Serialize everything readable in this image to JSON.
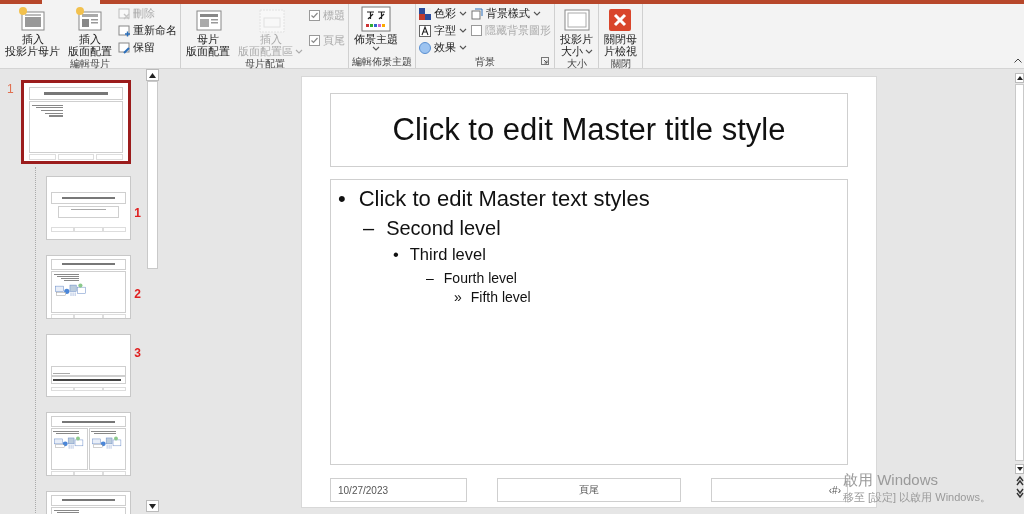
{
  "ribbon": {
    "groups": [
      {
        "label": "編輯母片",
        "items": [
          {
            "kind": "large",
            "lines": [
              "插入",
              "投影片母片"
            ],
            "disabled": false,
            "dropdown": false
          },
          {
            "kind": "large",
            "lines": [
              "插入",
              "版面配置"
            ],
            "disabled": false,
            "dropdown": false
          },
          {
            "kind": "stack",
            "entries": [
              {
                "label": "刪除",
                "disabled": true
              },
              {
                "label": "重新命名",
                "disabled": false
              },
              {
                "label": "保留",
                "disabled": false
              }
            ]
          }
        ]
      },
      {
        "label": "母片配置",
        "items": [
          {
            "kind": "large",
            "lines": [
              "母片",
              "版面配置"
            ],
            "disabled": false,
            "dropdown": false
          },
          {
            "kind": "large",
            "lines": [
              "插入",
              "版面配置區"
            ],
            "disabled": true,
            "dropdown": true
          },
          {
            "kind": "checks",
            "entries": [
              {
                "label": "標題",
                "checked": true,
                "disabled": true
              },
              {
                "label": "頁尾",
                "checked": true,
                "disabled": true
              }
            ]
          }
        ]
      },
      {
        "label": "編輯佈景主題",
        "items": [
          {
            "kind": "large",
            "lines": [
              "佈景主題"
            ],
            "disabled": false,
            "dropdown": true
          }
        ]
      },
      {
        "label": "背景",
        "launcher": true,
        "items": [
          {
            "kind": "menus",
            "entries": [
              {
                "label": "色彩"
              },
              {
                "label": "字型"
              },
              {
                "label": "效果"
              }
            ]
          },
          {
            "kind": "mixed",
            "entries": [
              {
                "kind": "menu",
                "label": "背景樣式",
                "disabled": false
              },
              {
                "kind": "check",
                "label": "隱藏背景圖形",
                "checked": false,
                "disabled": true
              }
            ]
          }
        ]
      },
      {
        "label": "大小",
        "items": [
          {
            "kind": "large",
            "lines": [
              "投影片",
              "大小"
            ],
            "disabled": false,
            "dropdown": true
          }
        ]
      },
      {
        "label": "關閉",
        "items": [
          {
            "kind": "large",
            "lines": [
              "關閉母",
              "片檢視"
            ],
            "disabled": false,
            "dropdown": false
          }
        ]
      }
    ]
  },
  "thumbnails": [
    {
      "kind": "content",
      "number": "1",
      "selected": true
    },
    {
      "kind": "title",
      "selected": false,
      "annotation": "1"
    },
    {
      "kind": "content-picture",
      "selected": false,
      "annotation": "2"
    },
    {
      "kind": "section",
      "selected": false,
      "annotation": "3"
    },
    {
      "kind": "two-picture",
      "selected": false
    },
    {
      "kind": "content",
      "selected": false
    }
  ],
  "slide": {
    "title": "Click to edit Master title style",
    "body": [
      {
        "text": "Click to edit Master text styles",
        "bullet": "•",
        "children": [
          {
            "text": "Second level",
            "bullet": "–",
            "children": [
              {
                "text": "Third level",
                "bullet": "•",
                "children": [
                  {
                    "text": "Fourth level",
                    "bullet": "–",
                    "children": [
                      {
                        "text": "Fifth level",
                        "bullet": "»"
                      }
                    ]
                  }
                ]
              }
            ]
          }
        ]
      }
    ],
    "date": "10/27/2023",
    "footer": "頁尾",
    "number": "‹#›"
  },
  "activation": {
    "title": "啟用 Windows",
    "message": "移至 [設定] 以啟用 Windows。"
  }
}
